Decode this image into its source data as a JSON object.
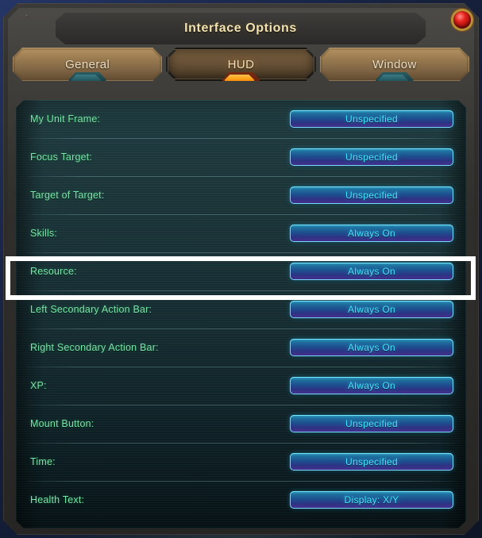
{
  "window": {
    "title": "Interface Options",
    "close_icon": "red-gem-close-icon"
  },
  "tabs": [
    {
      "label": "General",
      "active": false
    },
    {
      "label": "HUD",
      "active": true
    },
    {
      "label": "Window",
      "active": false
    }
  ],
  "options": [
    {
      "label": "My Unit Frame:",
      "value": "Unspecified",
      "highlighted": false
    },
    {
      "label": "Focus Target:",
      "value": "Unspecified",
      "highlighted": false
    },
    {
      "label": "Target of Target:",
      "value": "Unspecified",
      "highlighted": false
    },
    {
      "label": "Skills:",
      "value": "Always On",
      "highlighted": false
    },
    {
      "label": "Resource:",
      "value": "Always On",
      "highlighted": true
    },
    {
      "label": "Left Secondary Action Bar:",
      "value": "Always On",
      "highlighted": false
    },
    {
      "label": "Right Secondary Action Bar:",
      "value": "Always On",
      "highlighted": false
    },
    {
      "label": "XP:",
      "value": "Always On",
      "highlighted": false
    },
    {
      "label": "Mount Button:",
      "value": "Unspecified",
      "highlighted": false
    },
    {
      "label": "Time:",
      "value": "Unspecified",
      "highlighted": false
    },
    {
      "label": "Health Text:",
      "value": "Display: X/Y",
      "highlighted": false
    }
  ],
  "colors": {
    "title_text": "#f3e3b0",
    "label_text": "#77e6a6",
    "button_text": "#46e4ff",
    "button_border": "#78e6ff",
    "active_tab_gem": "#ff9a12",
    "inactive_tab_gem": "#245a63",
    "close_gem": "#e8221c",
    "highlight_box": "#ffffff"
  }
}
